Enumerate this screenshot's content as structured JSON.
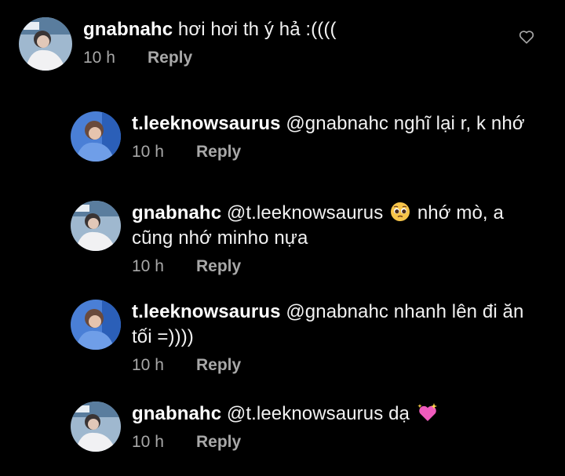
{
  "comments": [
    {
      "username": "gnabnahc",
      "text_before": " hơi hơi th ý hả :((((",
      "line2": "",
      "time": "10 h",
      "reply_label": "Reply"
    },
    {
      "username": "t.leeknowsaurus",
      "text_before": " @gnabnahc nghĩ lại r, k nhớ",
      "line2": "",
      "time": "10 h",
      "reply_label": "Reply"
    },
    {
      "username": "gnabnahc",
      "text_before": " @t.leeknowsaurus ",
      "emoji": "pleading-face-emoji",
      "text_after": " nhớ mò, a",
      "line2": "cũng nhớ minho nựa",
      "time": "10 h",
      "reply_label": "Reply"
    },
    {
      "username": "t.leeknowsaurus",
      "text_before": " @gnabnahc nhanh lên đi ăn",
      "line2": "tối =))))",
      "time": "10 h",
      "reply_label": "Reply"
    },
    {
      "username": "gnabnahc",
      "text_before": " @t.leeknowsaurus dạ ",
      "emoji": "sparkling-heart-emoji",
      "line2": "",
      "time": "10 h",
      "reply_label": "Reply"
    }
  ],
  "icons": {
    "like": "heart-outline-icon"
  },
  "colors": {
    "background": "#000000",
    "text": "#f2f2f2",
    "meta": "#a8a8a8"
  }
}
